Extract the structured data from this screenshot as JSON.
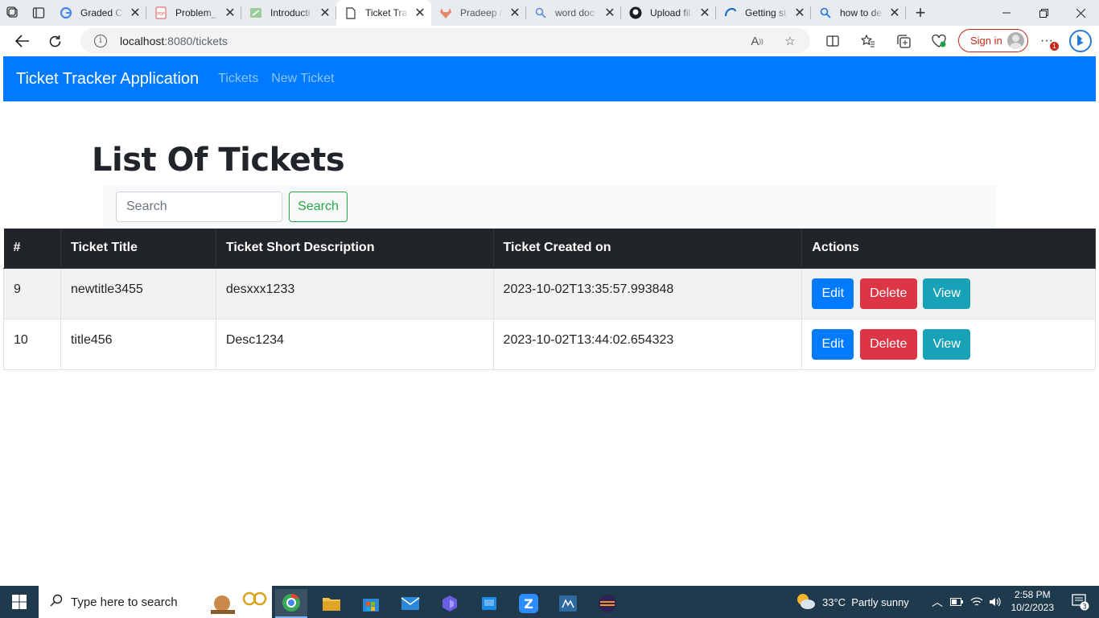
{
  "browser": {
    "tabs": [
      {
        "title": "Graded Cr",
        "icon": "google-icon"
      },
      {
        "title": "Problem_",
        "icon": "pdf-icon"
      },
      {
        "title": "Introducti",
        "icon": "doc-green-icon"
      },
      {
        "title": "Ticket Trac",
        "icon": "page-icon",
        "active": true
      },
      {
        "title": "Pradeep /",
        "icon": "gitlab-icon"
      },
      {
        "title": "word doc",
        "icon": "search-icon"
      },
      {
        "title": "Upload fil",
        "icon": "github-icon"
      },
      {
        "title": "Getting st",
        "icon": "edge-icon"
      },
      {
        "title": "how to de",
        "icon": "search-icon"
      }
    ],
    "url_host": "localhost",
    "url_path": ":8080/tickets",
    "sign_in_label": "Sign in",
    "notification_count": "1"
  },
  "app": {
    "brand": "Ticket Tracker Application",
    "nav": {
      "tickets": "Tickets",
      "new_ticket": "New Ticket"
    },
    "page_title": "List Of Tickets",
    "search": {
      "placeholder": "Search",
      "button_label": "Search"
    },
    "table": {
      "headers": [
        "#",
        "Ticket Title",
        "Ticket Short Description",
        "Ticket Created on",
        "Actions"
      ],
      "rows": [
        {
          "id": "9",
          "title": "newtitle3455",
          "description": "desxxx1233",
          "created": "2023-10-02T13:35:57.993848"
        },
        {
          "id": "10",
          "title": "title456",
          "description": "Desc1234",
          "created": "2023-10-02T13:44:02.654323"
        }
      ],
      "actions": {
        "edit": "Edit",
        "delete": "Delete",
        "view": "View"
      }
    }
  },
  "taskbar": {
    "search_placeholder": "Type here to search",
    "weather": "33°C  Partly sunny",
    "time": "2:58 PM",
    "date": "10/2/2023",
    "notification_count": "3"
  },
  "colors": {
    "navbar": "#007bff",
    "edit": "#007bff",
    "delete": "#dc3545",
    "view": "#17a2b8",
    "search_outline": "#28a745",
    "table_header": "#212529"
  }
}
